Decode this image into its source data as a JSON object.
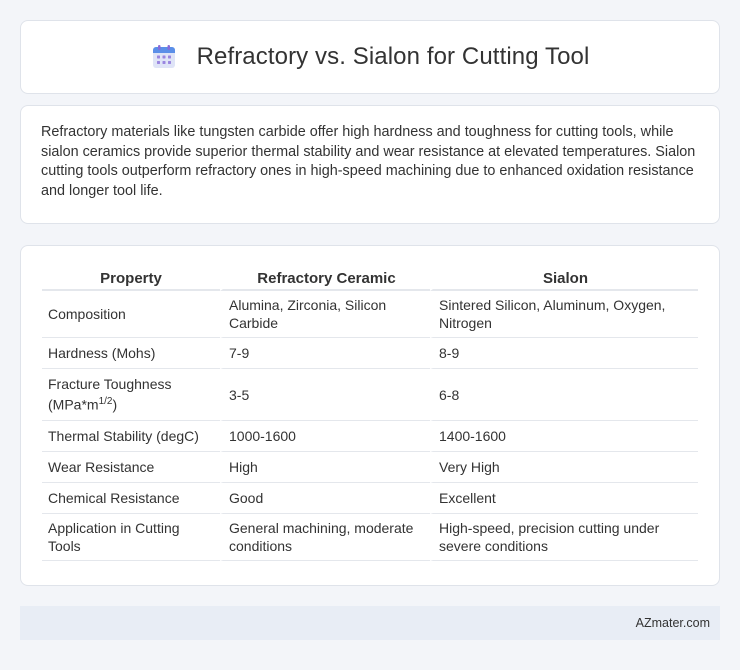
{
  "header": {
    "title": "Refractory vs. Sialon for Cutting Tool",
    "icon": "calendar-icon"
  },
  "intro": {
    "text": "Refractory materials like tungsten carbide offer high hardness and toughness for cutting tools, while sialon ceramics provide superior thermal stability and wear resistance at elevated temperatures. Sialon cutting tools outperform refractory ones in high-speed machining due to enhanced oxidation resistance and longer tool life."
  },
  "table": {
    "headers": [
      "Property",
      "Refractory Ceramic",
      "Sialon"
    ],
    "rows": [
      [
        "Composition",
        "Alumina, Zirconia, Silicon Carbide",
        "Sintered Silicon, Aluminum, Oxygen, Nitrogen"
      ],
      [
        "Hardness (Mohs)",
        "7-9",
        "8-9"
      ],
      [
        "Fracture Toughness (MPa*m",
        "3-5",
        "6-8"
      ],
      [
        "Thermal Stability (degC)",
        "1000-1600",
        "1400-1600"
      ],
      [
        "Wear Resistance",
        "High",
        "Very High"
      ],
      [
        "Chemical Resistance",
        "Good",
        "Excellent"
      ],
      [
        "Application in Cutting Tools",
        "General machining, moderate conditions",
        "High-speed, precision cutting under severe conditions"
      ]
    ],
    "toughness_exponent": "1/2",
    "toughness_close": ")"
  },
  "footer": {
    "brand": "AZmater.com"
  }
}
